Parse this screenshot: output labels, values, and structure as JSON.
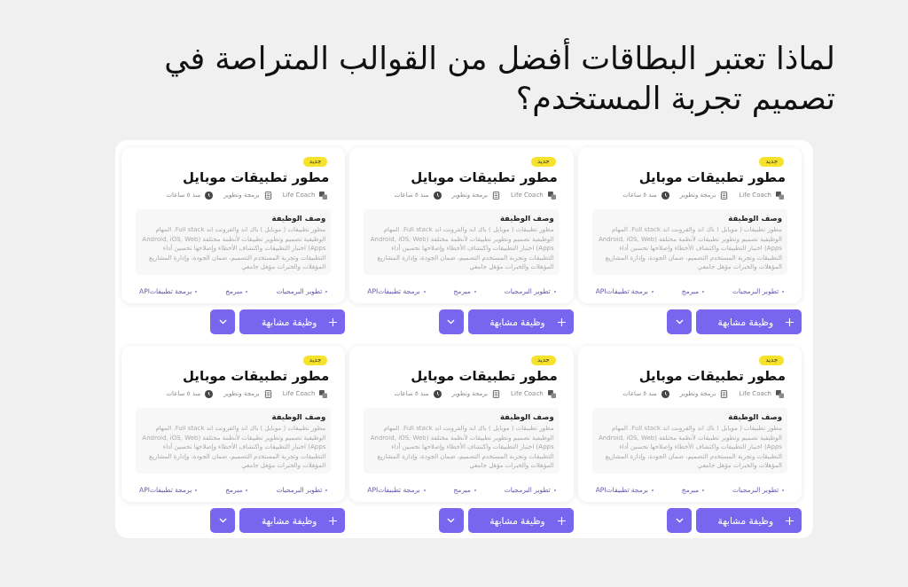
{
  "title": "لماذا تعتبر البطاقات أفضل من القوالب المتراصة في تصميم تجربة المستخدم؟",
  "cards": [
    {
      "badge": "جديد",
      "title": "مطور تطبيقات موبايل",
      "meta": [
        {
          "kind": "company",
          "text": "Life Coach"
        },
        {
          "kind": "category",
          "text": "برمجة وتطوير"
        },
        {
          "kind": "time",
          "text": "منذ ٥ ساعات"
        }
      ],
      "description": {
        "heading": "وصف الوظيفة",
        "body": "مطور تطبيقات ( موبايل ) باك اند والفرونت اند Full stack. المهام الوظيفية تصميم وتطوير تطبيقات لأنظمة مختلفة (Android, iOS, Web Apps) اختبار التطبيقات واكتشاف الأخطاء وإصلاحها تحسين أداء التطبيقات وتجربة المستخدم التصميم، ضمان الجودة، وإدارة المشاريع المؤهلات والخبرات مؤهل جامعي"
      },
      "tags": [
        "تطوير البرمجيات",
        "مبرمج",
        "برمجة تطبيقاتAPI"
      ],
      "action": "وظيفة مشابهة"
    },
    {
      "badge": "جديد",
      "title": "مطور تطبيقات موبايل",
      "meta": [
        {
          "kind": "company",
          "text": "Life Coach"
        },
        {
          "kind": "category",
          "text": "برمجة وتطوير"
        },
        {
          "kind": "time",
          "text": "منذ ٥ ساعات"
        }
      ],
      "description": {
        "heading": "وصف الوظيفة",
        "body": "مطور تطبيقات ( موبايل ) باك اند والفرونت اند Full stack. المهام الوظيفية تصميم وتطوير تطبيقات لأنظمة مختلفة (Android, iOS, Web Apps) اختبار التطبيقات واكتشاف الأخطاء وإصلاحها تحسين أداء التطبيقات وتجربة المستخدم التصميم، ضمان الجودة، وإدارة المشاريع المؤهلات والخبرات مؤهل جامعي"
      },
      "tags": [
        "تطوير البرمجيات",
        "مبرمج",
        "برمجة تطبيقاتAPI"
      ],
      "action": "وظيفة مشابهة"
    },
    {
      "badge": "جديد",
      "title": "مطور تطبيقات موبايل",
      "meta": [
        {
          "kind": "company",
          "text": "Life Coach"
        },
        {
          "kind": "category",
          "text": "برمجة وتطوير"
        },
        {
          "kind": "time",
          "text": "منذ ٥ ساعات"
        }
      ],
      "description": {
        "heading": "وصف الوظيفة",
        "body": "مطور تطبيقات ( موبايل ) باك اند والفرونت اند Full stack. المهام الوظيفية تصميم وتطوير تطبيقات لأنظمة مختلفة (Android, iOS, Web Apps) اختبار التطبيقات واكتشاف الأخطاء وإصلاحها تحسين أداء التطبيقات وتجربة المستخدم التصميم، ضمان الجودة، وإدارة المشاريع المؤهلات والخبرات مؤهل جامعي"
      },
      "tags": [
        "تطوير البرمجيات",
        "مبرمج",
        "برمجة تطبيقاتAPI"
      ],
      "action": "وظيفة مشابهة"
    },
    {
      "badge": "جديد",
      "title": "مطور تطبيقات موبايل",
      "meta": [
        {
          "kind": "company",
          "text": "Life Coach"
        },
        {
          "kind": "category",
          "text": "برمجة وتطوير"
        },
        {
          "kind": "time",
          "text": "منذ ٥ ساعات"
        }
      ],
      "description": {
        "heading": "وصف الوظيفة",
        "body": "مطور تطبيقات ( موبايل ) باك اند والفرونت اند Full stack. المهام الوظيفية تصميم وتطوير تطبيقات لأنظمة مختلفة (Android, iOS, Web Apps) اختبار التطبيقات واكتشاف الأخطاء وإصلاحها تحسين أداء التطبيقات وتجربة المستخدم التصميم، ضمان الجودة، وإدارة المشاريع المؤهلات والخبرات مؤهل جامعي"
      },
      "tags": [
        "تطوير البرمجيات",
        "مبرمج",
        "برمجة تطبيقاتAPI"
      ],
      "action": "وظيفة مشابهة"
    },
    {
      "badge": "جديد",
      "title": "مطور تطبيقات موبايل",
      "meta": [
        {
          "kind": "company",
          "text": "Life Coach"
        },
        {
          "kind": "category",
          "text": "برمجة وتطوير"
        },
        {
          "kind": "time",
          "text": "منذ ٥ ساعات"
        }
      ],
      "description": {
        "heading": "وصف الوظيفة",
        "body": "مطور تطبيقات ( موبايل ) باك اند والفرونت اند Full stack. المهام الوظيفية تصميم وتطوير تطبيقات لأنظمة مختلفة (Android, iOS, Web Apps) اختبار التطبيقات واكتشاف الأخطاء وإصلاحها تحسين أداء التطبيقات وتجربة المستخدم التصميم، ضمان الجودة، وإدارة المشاريع المؤهلات والخبرات مؤهل جامعي"
      },
      "tags": [
        "تطوير البرمجيات",
        "مبرمج",
        "برمجة تطبيقاتAPI"
      ],
      "action": "وظيفة مشابهة"
    },
    {
      "badge": "جديد",
      "title": "مطور تطبيقات موبايل",
      "meta": [
        {
          "kind": "company",
          "text": "Life Coach"
        },
        {
          "kind": "category",
          "text": "برمجة وتطوير"
        },
        {
          "kind": "time",
          "text": "منذ ٥ ساعات"
        }
      ],
      "description": {
        "heading": "وصف الوظيفة",
        "body": "مطور تطبيقات ( موبايل ) باك اند والفرونت اند Full stack. المهام الوظيفية تصميم وتطوير تطبيقات لأنظمة مختلفة (Android, iOS, Web Apps) اختبار التطبيقات واكتشاف الأخطاء وإصلاحها تحسين أداء التطبيقات وتجربة المستخدم التصميم، ضمان الجودة، وإدارة المشاريع المؤهلات والخبرات مؤهل جامعي"
      },
      "tags": [
        "تطوير البرمجيات",
        "مبرمج",
        "برمجة تطبيقاتAPI"
      ],
      "action": "وظيفة مشابهة"
    }
  ]
}
